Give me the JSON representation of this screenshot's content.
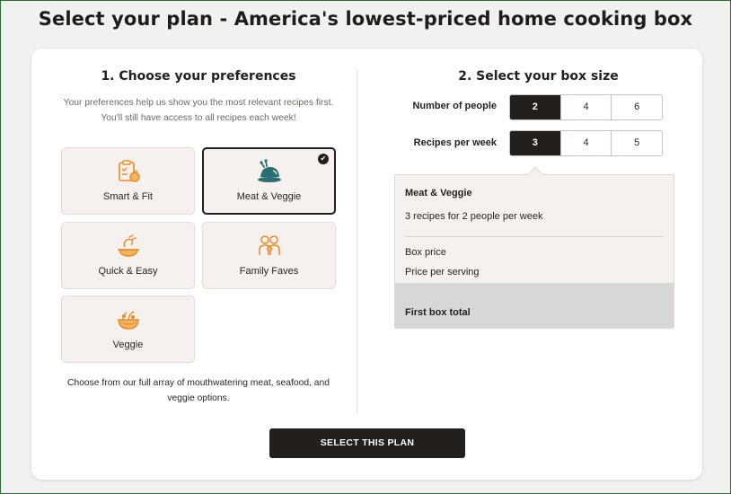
{
  "page": {
    "title": "Select your plan - America's lowest-priced home cooking box"
  },
  "preferences": {
    "title": "1. Choose your preferences",
    "description": "Your preferences help us show you the most relevant recipes first. You'll still have access to all recipes each week!",
    "footer": "Choose from our full array of mouthwatering meat, seafood, and veggie options.",
    "selected": "Meat & Veggie",
    "options": [
      {
        "label": "Smart & Fit",
        "icon": "clipboard-apple-icon"
      },
      {
        "label": "Meat & Veggie",
        "icon": "roast-chicken-icon"
      },
      {
        "label": "Quick & Easy",
        "icon": "cooking-pot-icon"
      },
      {
        "label": "Family Faves",
        "icon": "family-icon"
      },
      {
        "label": "Veggie",
        "icon": "veggie-bowl-icon"
      }
    ],
    "check_glyph": "✔"
  },
  "box_size": {
    "title": "2. Select your box size",
    "people_label": "Number of people",
    "people_options": [
      "2",
      "4",
      "6"
    ],
    "people_selected": "2",
    "recipes_label": "Recipes per week",
    "recipes_options": [
      "3",
      "4",
      "5"
    ],
    "recipes_selected": "3"
  },
  "summary": {
    "plan": "Meat & Veggie",
    "subtitle": "3 recipes for 2 people per week",
    "box_price_label": "Box price",
    "price_per_serving_label": "Price per serving",
    "first_box_total_label": "First box total"
  },
  "cta": {
    "label": "SELECT THIS PLAN"
  },
  "colors": {
    "accent_dark": "#231f1c",
    "icon_orange": "#e88a2a",
    "icon_teal": "#2b6d72",
    "frame_green": "#2e6b34"
  }
}
